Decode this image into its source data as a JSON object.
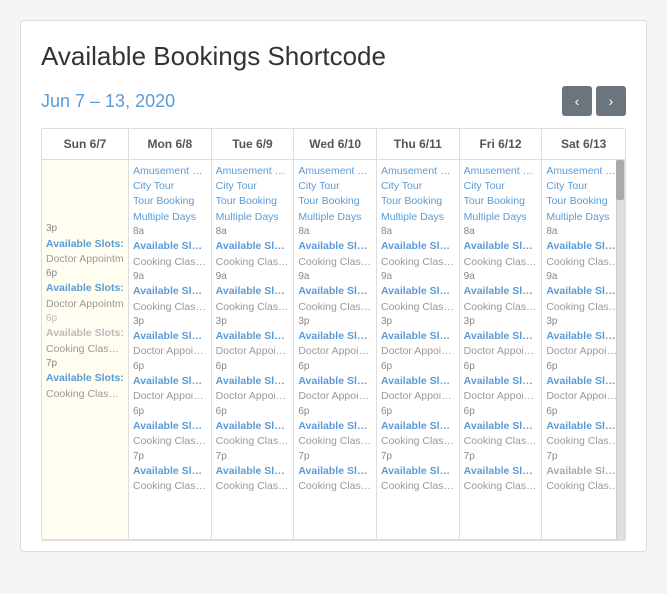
{
  "title": "Available Bookings Shortcode",
  "dateRange": "Jun 7 – 13, 2020",
  "nav": {
    "prev": "‹",
    "next": "›"
  },
  "headers": [
    "Sun 6/7",
    "Mon 6/8",
    "Tue 6/9",
    "Wed 6/10",
    "Thu 6/11",
    "Fri 6/12",
    "Sat 6/13"
  ],
  "days": [
    {
      "key": "sun",
      "events": [
        {
          "type": "gray",
          "text": ""
        },
        {
          "type": "time",
          "text": "3p"
        },
        {
          "type": "bold",
          "text": "Available Slots: "
        },
        {
          "type": "gray",
          "text": "Doctor Appointm"
        },
        {
          "type": "time",
          "text": "6p"
        },
        {
          "type": "bold",
          "text": "Available Slots: "
        },
        {
          "type": "gray",
          "text": "Doctor Appointm"
        },
        {
          "type": "time-gray",
          "text": "6p"
        },
        {
          "type": "bold-gray",
          "text": "Available Slots: "
        },
        {
          "type": "gray",
          "text": "Cooking Class Mo"
        },
        {
          "type": "time",
          "text": "7p"
        },
        {
          "type": "bold",
          "text": "Available Slots: "
        },
        {
          "type": "gray",
          "text": "Cooking Class Mo"
        }
      ]
    },
    {
      "key": "mon",
      "events": [
        {
          "type": "blue",
          "text": "Amusement Park"
        },
        {
          "type": "blue",
          "text": "City Tour"
        },
        {
          "type": "blue",
          "text": "Tour Booking"
        },
        {
          "type": "blue",
          "text": "Multiple Days"
        },
        {
          "type": "time",
          "text": "8a"
        },
        {
          "type": "bold",
          "text": "Available Slots: "
        },
        {
          "type": "gray",
          "text": "Cooking Class Mo"
        },
        {
          "type": "time",
          "text": "9a"
        },
        {
          "type": "bold",
          "text": "Available Slots: "
        },
        {
          "type": "gray",
          "text": "Cooking Class Mo"
        },
        {
          "type": "time",
          "text": "3p"
        },
        {
          "type": "bold",
          "text": "Available Slots: "
        },
        {
          "type": "gray",
          "text": "Doctor Appointm"
        },
        {
          "type": "time",
          "text": "6p"
        },
        {
          "type": "bold",
          "text": "Available Slots: "
        },
        {
          "type": "gray",
          "text": "Doctor Appointm"
        },
        {
          "type": "time",
          "text": "6p"
        },
        {
          "type": "bold",
          "text": "Available Slots: "
        },
        {
          "type": "gray",
          "text": "Cooking Class Mo"
        },
        {
          "type": "time",
          "text": "7p"
        },
        {
          "type": "bold",
          "text": "Available Slots: "
        },
        {
          "type": "gray",
          "text": "Cooking Class Mo"
        }
      ]
    },
    {
      "key": "tue",
      "events": [
        {
          "type": "blue",
          "text": "Amusement Park"
        },
        {
          "type": "blue",
          "text": "City Tour"
        },
        {
          "type": "blue",
          "text": "Tour Booking"
        },
        {
          "type": "blue",
          "text": "Multiple Days"
        },
        {
          "type": "time",
          "text": "8a"
        },
        {
          "type": "bold",
          "text": "Available Slots: "
        },
        {
          "type": "gray",
          "text": "Cooking Class Mo"
        },
        {
          "type": "time",
          "text": "9a"
        },
        {
          "type": "bold",
          "text": "Available Slots: "
        },
        {
          "type": "gray",
          "text": "Cooking Class Mo"
        },
        {
          "type": "time",
          "text": "3p"
        },
        {
          "type": "bold",
          "text": "Available Slots: "
        },
        {
          "type": "gray",
          "text": "Doctor Appointm"
        },
        {
          "type": "time",
          "text": "6p"
        },
        {
          "type": "bold",
          "text": "Available Slots: "
        },
        {
          "type": "gray",
          "text": "Doctor Appointm"
        },
        {
          "type": "time",
          "text": "6p"
        },
        {
          "type": "bold",
          "text": "Available Slots: "
        },
        {
          "type": "gray",
          "text": "Cooking Class Mo"
        },
        {
          "type": "time",
          "text": "7p"
        },
        {
          "type": "bold",
          "text": "Available Slots: "
        },
        {
          "type": "gray",
          "text": "Cooking Class Mo"
        }
      ]
    },
    {
      "key": "wed",
      "events": [
        {
          "type": "blue",
          "text": "Amusement Park"
        },
        {
          "type": "blue",
          "text": "City Tour"
        },
        {
          "type": "blue",
          "text": "Tour Booking"
        },
        {
          "type": "blue",
          "text": "Multiple Days"
        },
        {
          "type": "time",
          "text": "8a"
        },
        {
          "type": "bold",
          "text": "Available Slots: "
        },
        {
          "type": "gray",
          "text": "Cooking Class Mo"
        },
        {
          "type": "time",
          "text": "9a"
        },
        {
          "type": "bold",
          "text": "Available Slots: "
        },
        {
          "type": "gray",
          "text": "Cooking Class Mo"
        },
        {
          "type": "time",
          "text": "3p"
        },
        {
          "type": "bold",
          "text": "Available Slots: "
        },
        {
          "type": "gray",
          "text": "Doctor Appointm"
        },
        {
          "type": "time",
          "text": "6p"
        },
        {
          "type": "bold",
          "text": "Available Slots: "
        },
        {
          "type": "gray",
          "text": "Doctor Appointm"
        },
        {
          "type": "time",
          "text": "6p"
        },
        {
          "type": "bold",
          "text": "Available Slots: "
        },
        {
          "type": "gray",
          "text": "Cooking Class Mo"
        },
        {
          "type": "time",
          "text": "7p"
        },
        {
          "type": "bold",
          "text": "Available Slots: "
        },
        {
          "type": "gray",
          "text": "Cooking Class Mo"
        }
      ]
    },
    {
      "key": "thu",
      "events": [
        {
          "type": "blue",
          "text": "Amusement Park"
        },
        {
          "type": "blue",
          "text": "City Tour"
        },
        {
          "type": "blue",
          "text": "Tour Booking"
        },
        {
          "type": "blue",
          "text": "Multiple Days"
        },
        {
          "type": "time",
          "text": "8a"
        },
        {
          "type": "bold",
          "text": "Available Slots: "
        },
        {
          "type": "gray",
          "text": "Cooking Class Mo"
        },
        {
          "type": "time",
          "text": "9a"
        },
        {
          "type": "bold",
          "text": "Available Slots: "
        },
        {
          "type": "gray",
          "text": "Cooking Class Mo"
        },
        {
          "type": "time",
          "text": "3p"
        },
        {
          "type": "bold",
          "text": "Available Slots: "
        },
        {
          "type": "gray",
          "text": "Doctor Appointm"
        },
        {
          "type": "time",
          "text": "6p"
        },
        {
          "type": "bold",
          "text": "Available Slots: "
        },
        {
          "type": "gray",
          "text": "Doctor Appointm"
        },
        {
          "type": "time",
          "text": "6p"
        },
        {
          "type": "bold",
          "text": "Available Slots: "
        },
        {
          "type": "gray",
          "text": "Cooking Class Mo"
        },
        {
          "type": "time",
          "text": "7p"
        },
        {
          "type": "bold",
          "text": "Available Slots: "
        },
        {
          "type": "gray",
          "text": "Cooking Class Mo"
        }
      ]
    },
    {
      "key": "fri",
      "events": [
        {
          "type": "blue",
          "text": "Amusement Park"
        },
        {
          "type": "blue",
          "text": "City Tour"
        },
        {
          "type": "blue",
          "text": "Tour Booking"
        },
        {
          "type": "blue",
          "text": "Multiple Days"
        },
        {
          "type": "time",
          "text": "8a"
        },
        {
          "type": "bold",
          "text": "Available Slots: "
        },
        {
          "type": "gray",
          "text": "Cooking Class Mo"
        },
        {
          "type": "time",
          "text": "9a"
        },
        {
          "type": "bold",
          "text": "Available Slots: "
        },
        {
          "type": "gray",
          "text": "Cooking Class Mo"
        },
        {
          "type": "time",
          "text": "3p"
        },
        {
          "type": "bold",
          "text": "Available Slots: "
        },
        {
          "type": "gray",
          "text": "Doctor Appointm"
        },
        {
          "type": "time",
          "text": "6p"
        },
        {
          "type": "bold",
          "text": "Available Slots: "
        },
        {
          "type": "gray",
          "text": "Doctor Appointm"
        },
        {
          "type": "time",
          "text": "6p"
        },
        {
          "type": "bold",
          "text": "Available Slots: "
        },
        {
          "type": "gray",
          "text": "Cooking Class Mo"
        },
        {
          "type": "time",
          "text": "7p"
        },
        {
          "type": "bold",
          "text": "Available Slots: "
        },
        {
          "type": "gray",
          "text": "Cooking Class Mo"
        }
      ]
    },
    {
      "key": "sat",
      "events": [
        {
          "type": "blue",
          "text": "Amusement Park"
        },
        {
          "type": "blue",
          "text": "City Tour"
        },
        {
          "type": "blue",
          "text": "Tour Booking"
        },
        {
          "type": "blue",
          "text": "Multiple Days"
        },
        {
          "type": "time",
          "text": "8a"
        },
        {
          "type": "bold",
          "text": "Available Slots: "
        },
        {
          "type": "gray",
          "text": "Cooking Class Mo"
        },
        {
          "type": "time",
          "text": "9a"
        },
        {
          "type": "bold",
          "text": "Available Slots: "
        },
        {
          "type": "gray",
          "text": "Cooking Class Mo"
        },
        {
          "type": "time",
          "text": "3p"
        },
        {
          "type": "bold",
          "text": "Available Slots: "
        },
        {
          "type": "gray",
          "text": "Doctor Appointm"
        },
        {
          "type": "time",
          "text": "6p"
        },
        {
          "type": "bold",
          "text": "Available Slots: "
        },
        {
          "type": "gray",
          "text": "Doctor Appointm"
        },
        {
          "type": "time",
          "text": "6p"
        },
        {
          "type": "bold",
          "text": "Available Slots: "
        },
        {
          "type": "gray",
          "text": "Cooking Class Mo"
        },
        {
          "type": "time",
          "text": "7p"
        },
        {
          "type": "bold-gray",
          "text": "Available Slots: "
        },
        {
          "type": "gray",
          "text": "Cooking Class Mo"
        }
      ]
    }
  ]
}
